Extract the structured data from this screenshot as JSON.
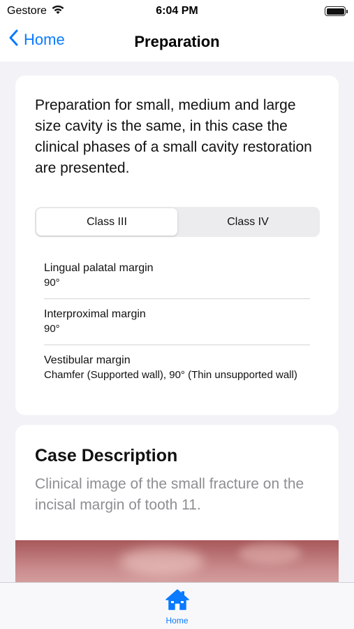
{
  "status_bar": {
    "carrier": "Gestore",
    "time": "6:04 PM"
  },
  "nav": {
    "back_label": "Home",
    "title": "Preparation"
  },
  "preparation": {
    "intro": "Preparation for small, medium and large size cavity is the same, in this case the clinical phases of a small cavity restoration are presented.",
    "segments": [
      {
        "label": "Class III",
        "selected": true
      },
      {
        "label": "Class IV",
        "selected": false
      }
    ],
    "rows": [
      {
        "label": "Lingual palatal margin",
        "value": "90°"
      },
      {
        "label": "Interproximal margin",
        "value": "90°"
      },
      {
        "label": "Vestibular margin",
        "value": "Chamfer (Supported wall), 90° (Thin unsupported wall)"
      }
    ]
  },
  "case": {
    "title": "Case Description",
    "description": "Clinical image of the small fracture on the incisal margin of tooth 11."
  },
  "tab_bar": {
    "items": [
      {
        "label": "Home",
        "icon": "house-icon"
      }
    ]
  },
  "colors": {
    "accent": "#0a7aff",
    "background": "#f2f2f7",
    "card": "#ffffff",
    "secondary_text": "#8e8e93"
  }
}
